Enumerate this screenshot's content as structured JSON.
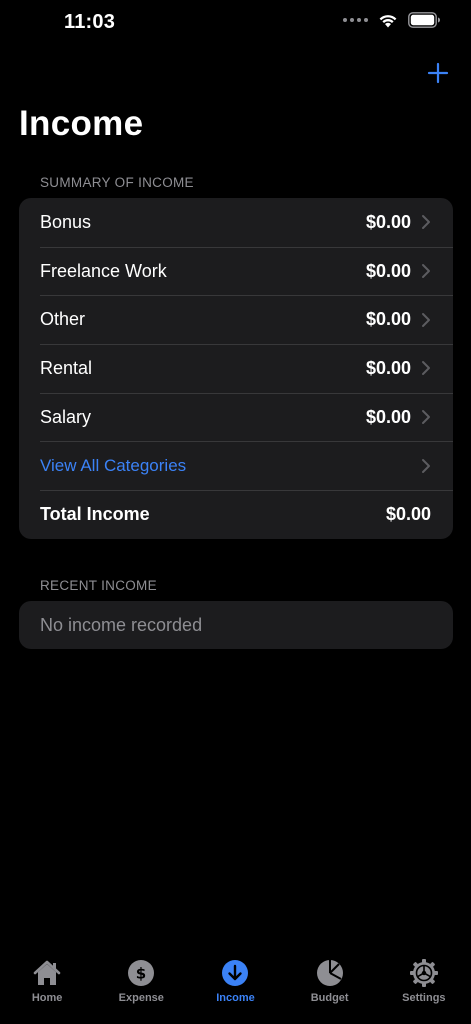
{
  "status": {
    "time": "11:03"
  },
  "page": {
    "title": "Income"
  },
  "summary": {
    "header": "SUMMARY OF INCOME",
    "rows": [
      {
        "label": "Bonus",
        "amount": "$0.00"
      },
      {
        "label": "Freelance Work",
        "amount": "$0.00"
      },
      {
        "label": "Other",
        "amount": "$0.00"
      },
      {
        "label": "Rental",
        "amount": "$0.00"
      },
      {
        "label": "Salary",
        "amount": "$0.00"
      }
    ],
    "view_all": "View All Categories",
    "total_label": "Total Income",
    "total_amount": "$0.00"
  },
  "recent": {
    "header": "RECENT INCOME",
    "empty": "No income recorded"
  },
  "tabs": [
    {
      "label": "Home",
      "icon": "house-icon"
    },
    {
      "label": "Expense",
      "icon": "dollar-circle-icon"
    },
    {
      "label": "Income",
      "icon": "arrow-down-circle-icon",
      "active": true
    },
    {
      "label": "Budget",
      "icon": "pie-chart-icon"
    },
    {
      "label": "Settings",
      "icon": "gear-icon"
    }
  ],
  "colors": {
    "accent": "#3b82f6",
    "card": "#1c1c1e",
    "secondary": "#8e8e93",
    "background": "#000000"
  }
}
